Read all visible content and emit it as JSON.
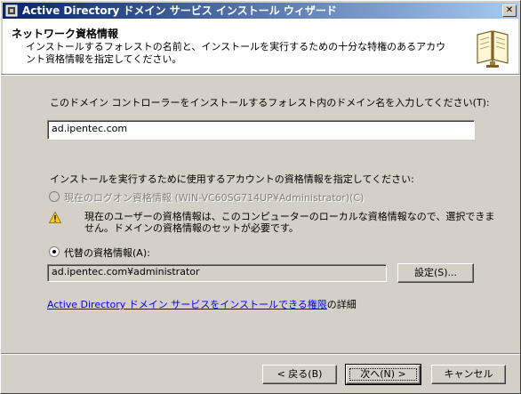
{
  "window": {
    "title": "Active Directory ドメイン サービス インストール ウィザード",
    "close_label": "✕"
  },
  "header": {
    "title": "ネットワーク資格情報",
    "description": "インストールするフォレストの名前と、インストールを実行するための十分な特権のあるアカウント資格情報を指定してください。"
  },
  "domain_section": {
    "prompt": "このドメイン コントローラーをインストールするフォレスト内のドメイン名を入力してください(T):",
    "domain_value": "ad.ipentec.com"
  },
  "credentials_section": {
    "prompt": "インストールを実行するために使用するアカウントの資格情報を指定してください:",
    "current_option_label": "現在のログオン資格情報 (WIN-VC60SG714UP¥Administrator)(C)",
    "current_option_selected": false,
    "current_option_enabled": false,
    "warning_text": "現在のユーザーの資格情報は、このコンピューターのローカルな資格情報なので、選択できません。ドメインの資格情報のセットが必要です。",
    "alternate_option_label": "代替の資格情報(A):",
    "alternate_option_selected": true,
    "alternate_value": "ad.ipentec.com¥administrator",
    "set_button": "設定(S)..."
  },
  "footer_link": {
    "link_text": "Active Directory ドメイン サービスをインストールできる権限",
    "suffix": "の詳細"
  },
  "buttons": {
    "back": "< 戻る(B)",
    "next": "次へ(N) >",
    "cancel": "キャンセル"
  }
}
